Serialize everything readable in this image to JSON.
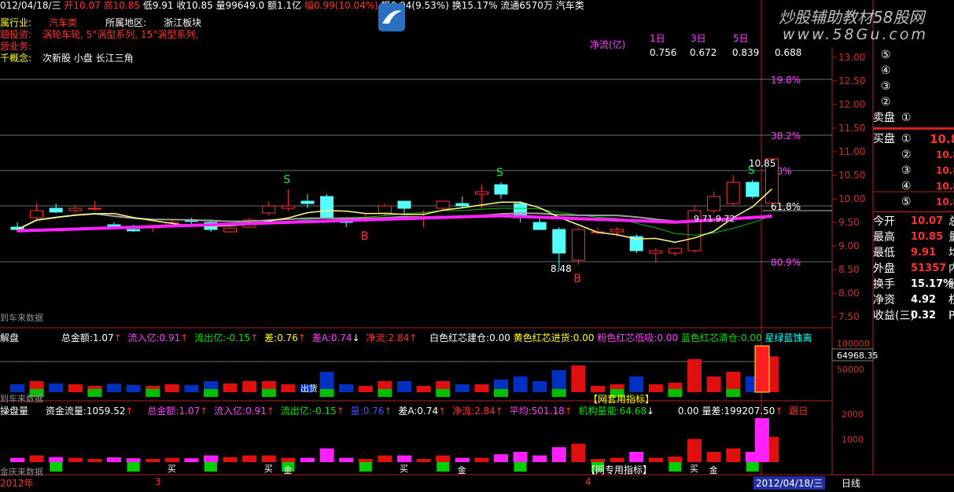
{
  "header": {
    "date": "012/04/18/三",
    "open_label": "开",
    "open": "10.07",
    "high_label": "高",
    "high": "10.85",
    "low_label": "低",
    "low": "9.91",
    "close_label": "收",
    "close": "10.85",
    "volume_label": "量",
    "volume": "99649.0",
    "amount_label": "额",
    "amount": "1.1亿",
    "range_label": "幅",
    "range": "0.99(10.04%)",
    "swing_label": "振",
    "swing": "0.94(9.53%)",
    "turnover_label": "换",
    "turnover": "15.17%",
    "float_label": "流通",
    "float": "6570万",
    "sector": "汽车类"
  },
  "info": {
    "industry_label": "属行业:",
    "industry": "汽车类",
    "region_label": "所属地区:",
    "region": "浙江板块",
    "hot_label": "题投资:",
    "hot": "涡轮车轮, 5°涡型系列, 15°涡型系列,",
    "business_label": "营业务:",
    "concept_label": "千概念:",
    "concept": "次新股 小盘 长江三角"
  },
  "netflow": {
    "label": "净流(亿)",
    "d1_label": "1日",
    "d3_label": "3日",
    "d5_label": "5日",
    "d1": "0.756",
    "d3": "0.672",
    "d5": "0.839",
    "extra": "0.688"
  },
  "watermark": {
    "cn": "炒股辅助教材58股网",
    "url": "www.58Gu.com"
  },
  "price_axis": [
    "13.00",
    "12.50",
    "12.00",
    "11.50",
    "11.00",
    "10.50",
    "10.00",
    "9.50",
    "9.00",
    "8.50",
    "8.00",
    "7.50"
  ],
  "fib_labels": [
    "19.8%",
    "38.2%",
    "50%",
    "61.8%",
    "80.9%"
  ],
  "chart_labels": {
    "high_price": "10.85",
    "low_price": "8.48",
    "pair": "9.71  9.72",
    "src": "到车来数据"
  },
  "chart_data": {
    "type": "candlestick",
    "ohlc": [
      [
        9.4,
        9.5,
        9.3,
        9.35
      ],
      [
        9.6,
        9.9,
        9.55,
        9.75
      ],
      [
        9.8,
        9.9,
        9.7,
        9.72
      ],
      [
        9.75,
        9.85,
        9.7,
        9.8
      ],
      [
        9.8,
        9.95,
        9.75,
        9.8
      ],
      [
        9.45,
        9.5,
        9.35,
        9.38
      ],
      [
        9.35,
        9.45,
        9.3,
        9.32
      ],
      [
        9.4,
        9.45,
        9.3,
        9.4
      ],
      [
        9.45,
        9.55,
        9.4,
        9.5
      ],
      [
        9.55,
        9.6,
        9.45,
        9.52
      ],
      [
        9.5,
        9.55,
        9.3,
        9.35
      ],
      [
        9.3,
        9.4,
        9.28,
        9.38
      ],
      [
        9.4,
        9.6,
        9.38,
        9.55
      ],
      [
        9.7,
        9.95,
        9.65,
        9.85
      ],
      [
        9.8,
        10.2,
        9.75,
        9.85
      ],
      [
        9.95,
        10.1,
        9.8,
        9.9
      ],
      [
        10.05,
        10.1,
        9.6,
        9.6
      ],
      [
        9.55,
        9.6,
        9.4,
        9.5
      ],
      [
        9.6,
        9.7,
        9.5,
        9.6
      ],
      [
        9.7,
        9.9,
        9.65,
        9.85
      ],
      [
        9.95,
        9.95,
        9.7,
        9.8
      ],
      [
        9.6,
        9.75,
        9.4,
        9.6
      ],
      [
        9.8,
        9.95,
        9.75,
        9.95
      ],
      [
        9.9,
        10.05,
        9.8,
        9.85
      ],
      [
        10.1,
        10.3,
        9.8,
        10.15
      ],
      [
        10.3,
        10.35,
        10.0,
        10.1
      ],
      [
        9.9,
        9.95,
        9.5,
        9.6
      ],
      [
        9.5,
        9.6,
        9.4,
        9.35
      ],
      [
        9.35,
        9.4,
        8.48,
        8.85
      ],
      [
        8.7,
        9.4,
        8.6,
        9.35
      ],
      [
        9.3,
        9.4,
        9.25,
        9.3
      ],
      [
        9.3,
        9.4,
        9.2,
        9.35
      ],
      [
        9.2,
        9.25,
        8.85,
        8.9
      ],
      [
        8.85,
        8.95,
        8.65,
        8.9
      ],
      [
        8.85,
        8.95,
        8.8,
        8.95
      ],
      [
        8.9,
        9.85,
        8.85,
        9.75
      ],
      [
        9.75,
        10.15,
        9.7,
        10.05
      ],
      [
        9.9,
        10.5,
        9.85,
        10.35
      ],
      [
        10.35,
        10.4,
        10.0,
        10.05
      ],
      [
        9.91,
        10.85,
        9.91,
        10.85
      ]
    ],
    "ylim": [
      7.5,
      13.0
    ]
  },
  "indicator1": {
    "title": "解盘",
    "total_label": "总金额:",
    "total": "1.07",
    "inflow_label": "流入亿:",
    "inflow": "0.91",
    "outflow_label": "流出亿:",
    "outflow": "-0.15",
    "diff_label": "差:",
    "diff": "0.76",
    "diffa_label": "差A:",
    "diffa": "0.74",
    "net_label": "净流:",
    "net": "2.84",
    "w_label": "白色红芯建仓:",
    "w": "0.00",
    "y_label": "黄色红芯进货:",
    "y": "0.00",
    "p_label": "粉色红芯低吸:",
    "p": "0.00",
    "b_label": "蓝色红芯清仓:",
    "b": "0.00",
    "g_label": "星绿蓝蚀离",
    "axis": [
      "100000",
      "64968.35",
      "50000"
    ],
    "caption": "【网套用指标】",
    "src": "到车来数据",
    "out_label": "出货"
  },
  "indicator2": {
    "title": "操盘量",
    "cap_label": "资金流量:",
    "cap": "1059.52",
    "total_label": "总金额:",
    "total": "1.07",
    "inflow_label": "流入亿:",
    "inflow": "0.91",
    "outflow_label": "流出亿:",
    "outflow": "-0.15",
    "blue_label": "量:",
    "blue": "0.76",
    "diffa_label": "差A:",
    "diffa": "0.74",
    "net_label": "净流:",
    "net": "2.84",
    "bal_label": "平均:",
    "bal": "501.18",
    "org_label": "机构量能:",
    "org": "64.68",
    "zero": "0.00",
    "vd_label": "量差:",
    "vd": "199207.50",
    "follow": "跟日",
    "axis": [
      "2000",
      "1000"
    ],
    "caption": "【网专用指标】",
    "src": "金庆来数据",
    "buy": "买",
    "gold": "金"
  },
  "timeline": {
    "year": "2012年",
    "m3": "3",
    "m4": "4",
    "cur": "2012/04/18/三",
    "period": "日线"
  },
  "side": {
    "sell_label": "卖盘",
    "buy_label": "买盘",
    "sell_nums": [
      "⑤",
      "④",
      "③",
      "②",
      "①"
    ],
    "buy_nums": [
      "①",
      "②",
      "③",
      "④",
      "⑤"
    ],
    "buy_vals": [
      "10.8",
      "10.8",
      "10.8",
      "10.8",
      "10.8"
    ],
    "stats": [
      {
        "k": "今开",
        "v": "10.07",
        "t": "总"
      },
      {
        "k": "最高",
        "v": "10.85",
        "t": "量"
      },
      {
        "k": "最低",
        "v": "9.91",
        "t": "均"
      },
      {
        "k": "外盘",
        "v": "51357",
        "t": "内"
      },
      {
        "k": "换手",
        "v": "15.17%",
        "t": "股"
      },
      {
        "k": "净资",
        "v": "4.92",
        "t": "权"
      },
      {
        "k": "收益(三)",
        "v": "0.32",
        "t": "P"
      }
    ]
  }
}
